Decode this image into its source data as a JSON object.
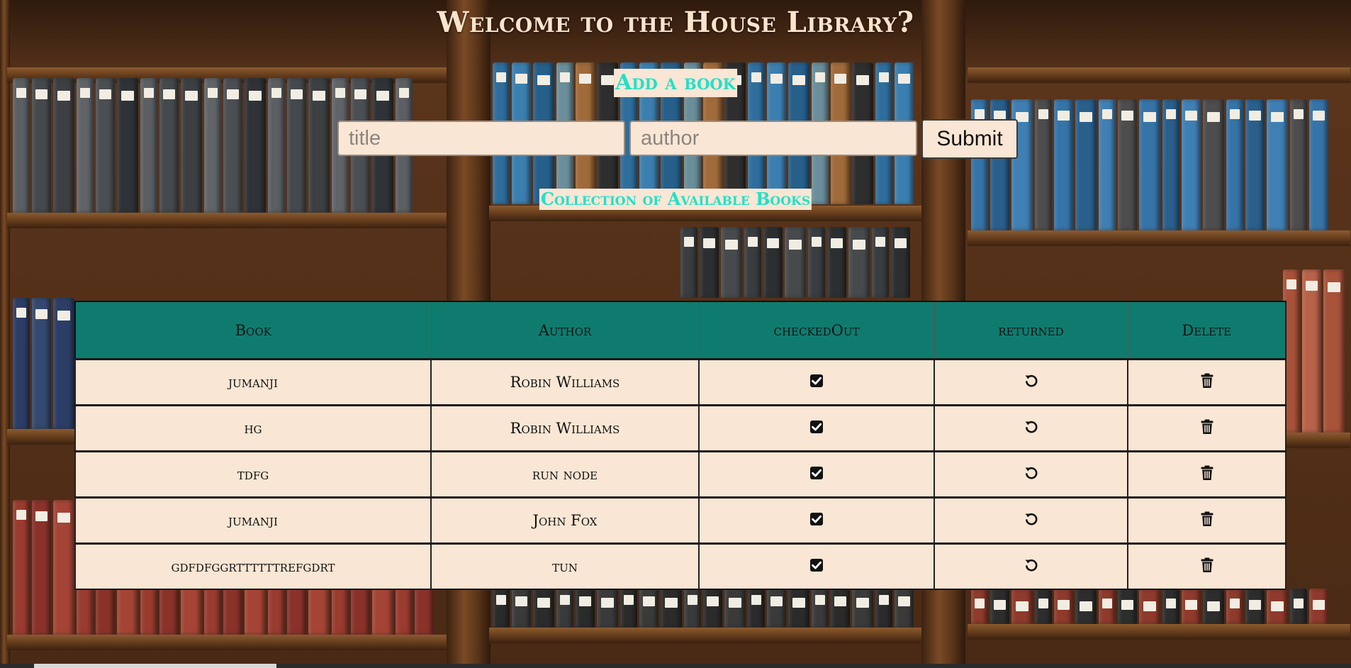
{
  "header": {
    "title": "Welcome to the House Library?"
  },
  "add_section": {
    "heading": "Add a book",
    "title_placeholder": "title",
    "author_placeholder": "author",
    "title_value": "",
    "author_value": "",
    "submit_label": "Submit"
  },
  "collection": {
    "heading": "Collection of Available Books",
    "columns": [
      "Book",
      "Author",
      "checkedOut",
      "returned",
      "Delete"
    ],
    "rows": [
      {
        "book": "jumanji",
        "author": "Robin Williams",
        "checked_out": true
      },
      {
        "book": "hg",
        "author": "Robin Williams",
        "checked_out": true
      },
      {
        "book": "tdfg",
        "author": "run node",
        "checked_out": true
      },
      {
        "book": "jumanji",
        "author": "John Fox",
        "checked_out": true
      },
      {
        "book": "gdfdfggrttttttrefgdrt",
        "author": "tun",
        "checked_out": true
      }
    ]
  },
  "icons": {
    "checked_out": "checkbox-checked-icon",
    "returned": "undo-icon",
    "delete": "trash-icon"
  },
  "colors": {
    "title_text": "#fbe4cc",
    "heading_text": "#22e0c8",
    "panel_bg": "#f9e6d4",
    "table_header_bg": "#0f7b6f"
  }
}
